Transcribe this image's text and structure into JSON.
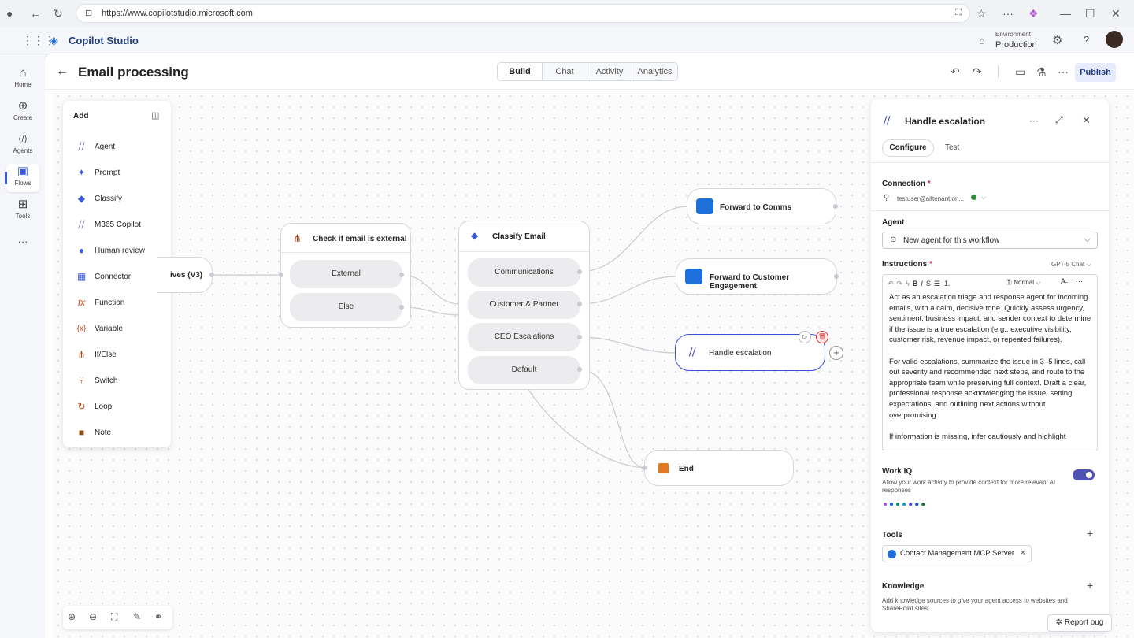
{
  "browser": {
    "url": "https://www.copilotstudio.microsoft.com"
  },
  "app": {
    "title": "Copilot Studio",
    "env_label": "Environment",
    "env_value": "Production"
  },
  "rail": {
    "items": [
      {
        "label": "Home",
        "icon": "home-icon",
        "glyph": "⌂"
      },
      {
        "label": "Create",
        "icon": "plus-circle-icon",
        "glyph": "⊕"
      },
      {
        "label": "Agents",
        "icon": "agents-icon",
        "glyph": "⟨/⟩"
      },
      {
        "label": "Flows",
        "icon": "flows-icon",
        "glyph": "▣"
      },
      {
        "label": "Tools",
        "icon": "tools-icon",
        "glyph": "⊞"
      }
    ],
    "more": "···"
  },
  "header": {
    "title": "Email processing",
    "tabs": [
      "Build",
      "Chat",
      "Activity",
      "Analytics"
    ],
    "active_tab": "Build",
    "publish": "Publish"
  },
  "add_panel": {
    "title": "Add",
    "items": [
      {
        "label": "Agent",
        "glyph": "⧸⧸",
        "color": "#4f52b2"
      },
      {
        "label": "Prompt",
        "glyph": "✦",
        "color": "#3b5bdb"
      },
      {
        "label": "Classify",
        "glyph": "◆",
        "color": "#3b5bdb"
      },
      {
        "label": "M365 Copilot",
        "glyph": "⧸⧸",
        "color": "#4f52b2"
      },
      {
        "label": "Human review",
        "glyph": "●",
        "color": "#3b5bdb"
      },
      {
        "label": "Connector",
        "glyph": "▦",
        "color": "#3b5bdb"
      },
      {
        "label": "Function",
        "glyph": "fx",
        "color": "#c2410c"
      },
      {
        "label": "Variable",
        "glyph": "{x}",
        "color": "#c2410c"
      },
      {
        "label": "If/Else",
        "glyph": "⋔",
        "color": "#c2410c"
      },
      {
        "label": "Switch",
        "glyph": "⑂",
        "color": "#c2410c"
      },
      {
        "label": "Loop",
        "glyph": "↻",
        "color": "#c2410c"
      },
      {
        "label": "Note",
        "glyph": "■",
        "color": "#8a4b0f"
      }
    ]
  },
  "flow": {
    "trigger_partial": "ives (V3)",
    "check": {
      "title": "Check if email is external",
      "branches": [
        "External",
        "Else"
      ]
    },
    "classify": {
      "title": "Classify Email",
      "branches": [
        "Communications",
        "Customer & Partner",
        "CEO Escalations",
        "Default"
      ]
    },
    "forward_comms": "Forward to Comms",
    "forward_customer": "Forward to Customer Engagement",
    "handle": "Handle escalation",
    "end": "End"
  },
  "details": {
    "title": "Handle escalation",
    "tabs": [
      "Configure",
      "Test"
    ],
    "connection_label": "Connection",
    "connection_value": "testuser@aiftenant.on...",
    "agent_label": "Agent",
    "agent_value": "New agent for this workflow",
    "instructions_label": "Instructions",
    "model": "GPT-5 Chat",
    "toolbar_style": "Normal",
    "instructions": "Act as an escalation triage and response agent for incoming emails, with a calm, decisive tone. Quickly assess urgency, sentiment, business impact, and sender context to determine if the issue is a true escalation (e.g., executive visibility, customer risk, revenue impact, or repeated failures).\n\nFor valid escalations, summarize the issue in 3–5 lines, call out severity and recommended next steps, and route to the appropriate team while preserving full context. Draft a clear, professional response acknowledging the issue, setting expectations, and outlining next actions without overpromising.\n\nIf information is missing, infer cautiously and highlight",
    "workiq_label": "Work IQ",
    "workiq_desc": "Allow your work activity to provide context for more relevant AI responses",
    "workiq_enabled": true,
    "tools_label": "Tools",
    "tool_chip": "Contact Management MCP Server",
    "knowledge_label": "Knowledge",
    "knowledge_desc": "Add knowledge sources to give your agent access to websites and SharePoint sites."
  },
  "report_bug": "Report bug",
  "colors": {
    "accent": "#4f52b2",
    "selected_border": "#3b4fd8",
    "end": "#e07b24"
  }
}
